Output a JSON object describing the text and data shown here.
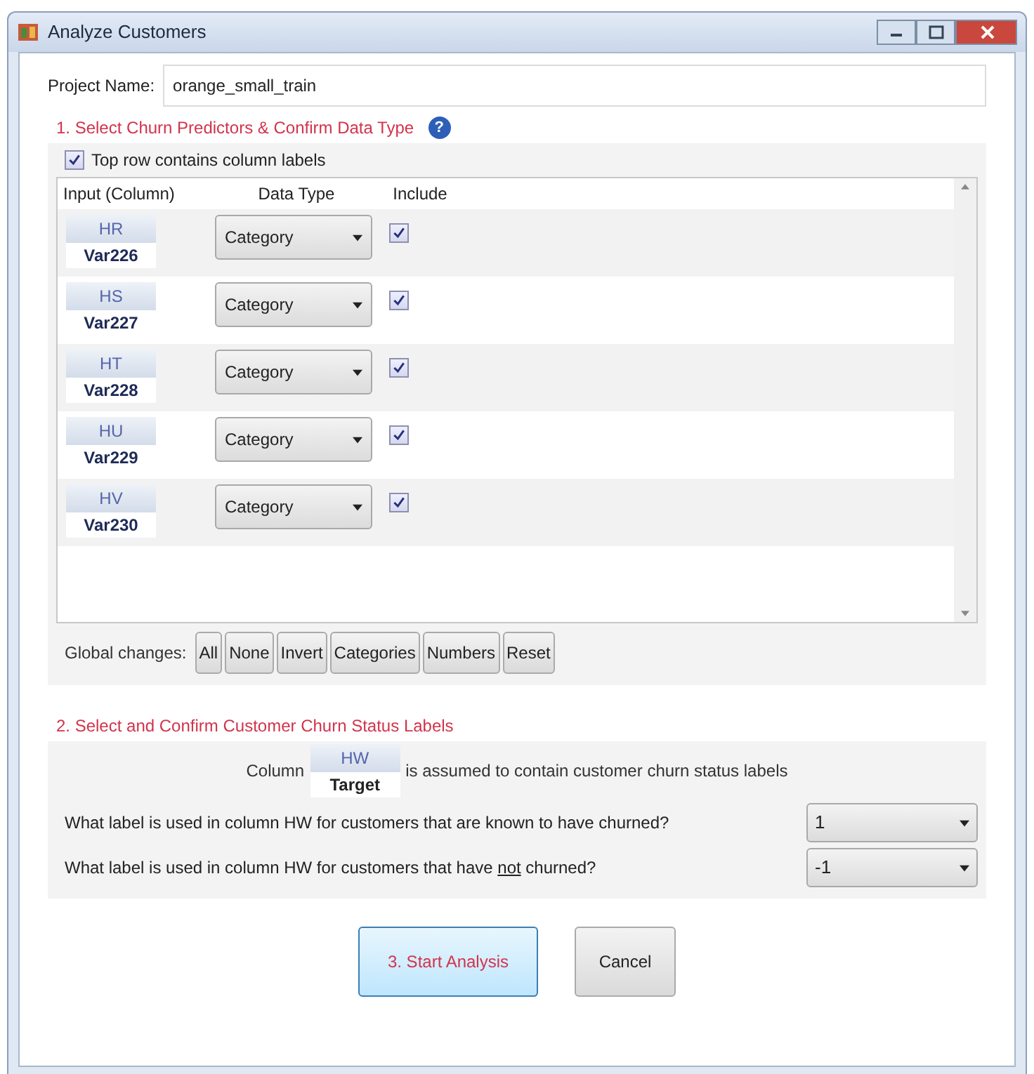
{
  "window": {
    "title": "Analyze Customers"
  },
  "project": {
    "label": "Project Name:",
    "value": "orange_small_train"
  },
  "section1": {
    "title": "1. Select Churn Predictors & Confirm Data Type",
    "help": "?",
    "top_row_labels": {
      "label": "Top row contains column labels",
      "checked": true
    },
    "columns": [
      "Input (Column)",
      "Data Type",
      "Include"
    ],
    "rows": [
      {
        "column": "HR",
        "name": "Var226",
        "data_type": "Category",
        "include": true
      },
      {
        "column": "HS",
        "name": "Var227",
        "data_type": "Category",
        "include": true
      },
      {
        "column": "HT",
        "name": "Var228",
        "data_type": "Category",
        "include": true
      },
      {
        "column": "HU",
        "name": "Var229",
        "data_type": "Category",
        "include": true
      },
      {
        "column": "HV",
        "name": "Var230",
        "data_type": "Category",
        "include": true
      }
    ],
    "global_label": "Global changes:",
    "global_buttons": [
      "All",
      "None",
      "Invert",
      "Categories",
      "Numbers",
      "Reset"
    ]
  },
  "section2": {
    "title": "2. Select and Confirm Customer Churn Status Labels",
    "column_prefix": "Column",
    "column": "HW",
    "column_name": "Target",
    "column_suffix": "is assumed to contain customer churn status labels",
    "questions": [
      {
        "text": "What label is used in column HW for customers that are known to have churned?",
        "value": "1"
      },
      {
        "text": "What label is used in column HW for customers that have *not* churned?",
        "value": "-1"
      }
    ]
  },
  "buttons": [
    {
      "label": "3. Start Analysis",
      "kind": "primary"
    },
    {
      "label": "Cancel",
      "kind": "normal"
    }
  ]
}
